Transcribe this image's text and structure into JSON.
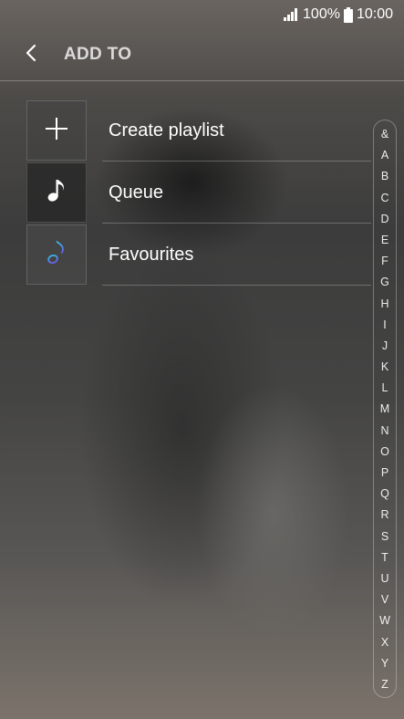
{
  "status_bar": {
    "battery_percent": "100%",
    "time": "10:00",
    "icons": [
      "signal-icon",
      "battery-icon"
    ]
  },
  "app_bar": {
    "title": "ADD TO",
    "back_icon": "chevron-left-icon"
  },
  "list": {
    "items": [
      {
        "label": "Create playlist",
        "icon": "plus-icon"
      },
      {
        "label": "Queue",
        "icon": "music-note-icon"
      },
      {
        "label": "Favourites",
        "icon": "music-note-gradient-icon"
      }
    ]
  },
  "index_bar": {
    "letters": [
      "&",
      "A",
      "B",
      "C",
      "D",
      "E",
      "F",
      "G",
      "H",
      "I",
      "J",
      "K",
      "L",
      "M",
      "N",
      "O",
      "P",
      "Q",
      "R",
      "S",
      "T",
      "U",
      "V",
      "W",
      "X",
      "Y",
      "Z"
    ]
  },
  "colors": {
    "favourite_gradient_top": "#37b7e8",
    "favourite_gradient_bottom": "#6e5ce8"
  }
}
